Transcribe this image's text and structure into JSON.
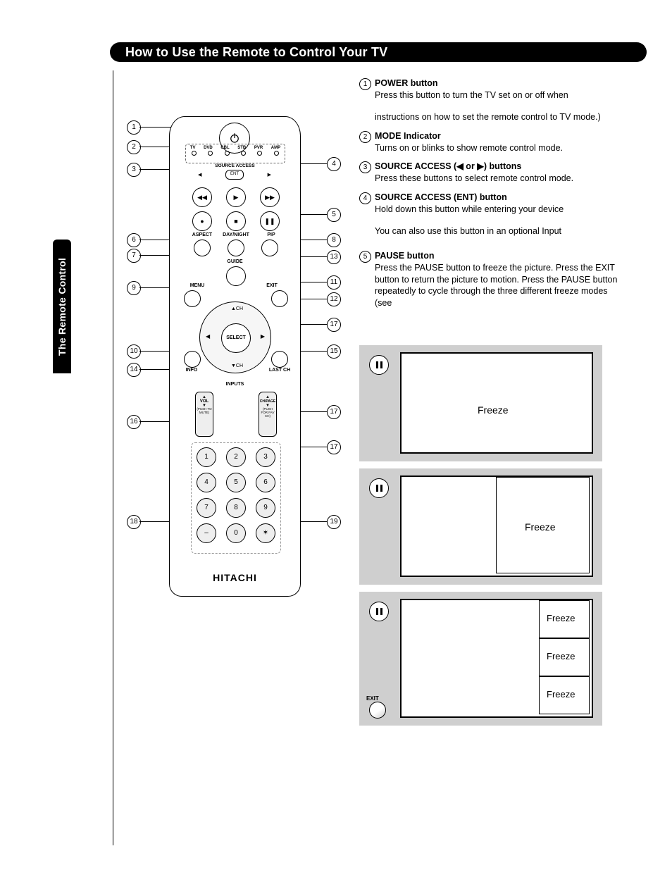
{
  "title": "How to Use the Remote to Control Your TV",
  "side_tab": "The Remote Control",
  "remote": {
    "brand": "HITACHI",
    "modes": [
      "TV",
      "DVD",
      "CBL",
      "STB",
      "PVR",
      "AMP"
    ],
    "source_access": "SOURCE ACCESS",
    "ent": "ENT",
    "aspect": "ASPECT",
    "daynight": "DAY/NIGHT",
    "pip": "PIP",
    "guide": "GUIDE",
    "menu": "MENU",
    "exit": "EXIT",
    "select": "SELECT",
    "info": "INFO",
    "lastch": "LAST CH",
    "inputs": "INPUTS",
    "vol": "VOL",
    "chpage": "CH/PAGE",
    "mute": "(PUSH TO MUTE)",
    "favch": "(PUSH FOR FAV CH)",
    "keys": [
      "1",
      "2",
      "3",
      "4",
      "5",
      "6",
      "7",
      "8",
      "9",
      "",
      "0",
      ""
    ]
  },
  "callouts": {
    "left": [
      "1",
      "2",
      "3",
      "6",
      "7",
      "9",
      "10",
      "14",
      "16",
      "18"
    ],
    "right": [
      "4",
      "5",
      "8",
      "13",
      "11",
      "12",
      "17",
      "15",
      "17",
      "17",
      "19"
    ]
  },
  "items": [
    {
      "n": "1",
      "title": "POWER button",
      "body": [
        "Press this button to turn the TV set on or off when",
        "instructions on how to set the remote control to TV mode.)"
      ]
    },
    {
      "n": "2",
      "title": "MODE Indicator",
      "body": [
        "Turns on or blinks to show remote control mode."
      ]
    },
    {
      "n": "3",
      "title": "SOURCE ACCESS (◀ or ▶) buttons",
      "body": [
        "Press these buttons to select remote control mode."
      ]
    },
    {
      "n": "4",
      "title": "SOURCE ACCESS (ENT) button",
      "body": [
        "Hold down this button while entering your device",
        "You can also use this button in an optional Input"
      ]
    },
    {
      "n": "5",
      "title": "PAUSE button",
      "body": [
        "Press the PAUSE button to freeze the picture.  Press the EXIT button to return the picture to motion.  Press the PAUSE button repeatedly to cycle through the three different freeze modes (see"
      ]
    }
  ],
  "freeze": {
    "label": "Freeze",
    "exit": "EXIT"
  }
}
